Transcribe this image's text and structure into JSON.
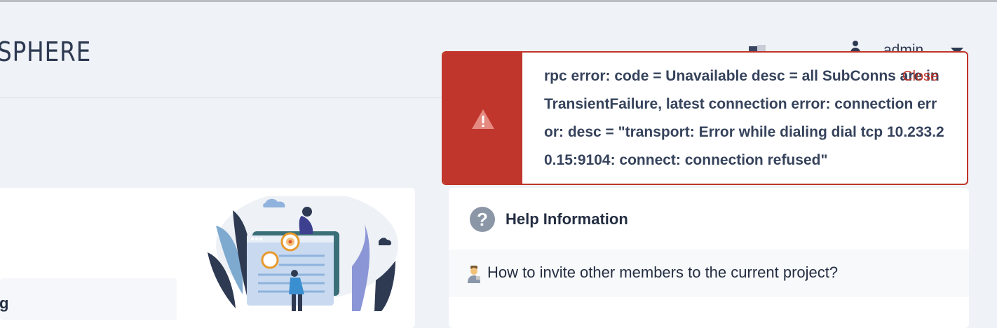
{
  "header": {
    "logo_text": "SPHERE",
    "username": "admin"
  },
  "alert": {
    "message": "rpc error: code = Unavailable desc = all SubConns are in TransientFailure, latest connection error: connection error: desc = \"transport: Error while dialing dial tcp 10.233.20.15:9104: connect: connection refused\"",
    "close_label": "Close",
    "icon": "warning-icon",
    "color": "#c0362c"
  },
  "left_card": {
    "partial_text": "g"
  },
  "help": {
    "icon_glyph": "?",
    "title": "Help Information",
    "items": [
      {
        "text": "How to invite other members to the current project?",
        "icon": "person-emoji-icon"
      }
    ]
  }
}
